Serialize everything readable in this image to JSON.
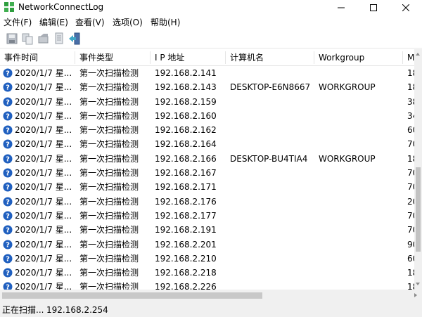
{
  "window": {
    "title": "NetworkConnectLog"
  },
  "menu": [
    {
      "label": "文件(F)"
    },
    {
      "label": "编辑(E)"
    },
    {
      "label": "查看(V)"
    },
    {
      "label": "选项(O)"
    },
    {
      "label": "帮助(H)"
    }
  ],
  "toolbar": {
    "icons": [
      "save-icon",
      "copy-icon",
      "properties-icon",
      "html-report-icon",
      "exit-icon"
    ]
  },
  "columns": [
    {
      "label": "事件时间"
    },
    {
      "label": "事件类型"
    },
    {
      "label": "I P 地址"
    },
    {
      "label": "计算机名"
    },
    {
      "label": "Workgroup"
    },
    {
      "label": "M"
    }
  ],
  "rows": [
    {
      "time": "2020/1/7 星...",
      "type": "第一次扫描检测",
      "ip": "192.168.2.141",
      "computer": "",
      "workgroup": "",
      "m": "18"
    },
    {
      "time": "2020/1/7 星...",
      "type": "第一次扫描检测",
      "ip": "192.168.2.143",
      "computer": "DESKTOP-E6N8667",
      "workgroup": "WORKGROUP",
      "m": "18"
    },
    {
      "time": "2020/1/7 星...",
      "type": "第一次扫描检测",
      "ip": "192.168.2.159",
      "computer": "",
      "workgroup": "",
      "m": "38"
    },
    {
      "time": "2020/1/7 星...",
      "type": "第一次扫描检测",
      "ip": "192.168.2.160",
      "computer": "",
      "workgroup": "",
      "m": "34"
    },
    {
      "time": "2020/1/7 星...",
      "type": "第一次扫描检测",
      "ip": "192.168.2.162",
      "computer": "",
      "workgroup": "",
      "m": "60"
    },
    {
      "time": "2020/1/7 星...",
      "type": "第一次扫描检测",
      "ip": "192.168.2.164",
      "computer": "",
      "workgroup": "",
      "m": "70"
    },
    {
      "time": "2020/1/7 星...",
      "type": "第一次扫描检测",
      "ip": "192.168.2.166",
      "computer": "DESKTOP-BU4TIA4",
      "workgroup": "WORKGROUP",
      "m": "18"
    },
    {
      "time": "2020/1/7 星...",
      "type": "第一次扫描检测",
      "ip": "192.168.2.167",
      "computer": "",
      "workgroup": "",
      "m": "70"
    },
    {
      "time": "2020/1/7 星...",
      "type": "第一次扫描检测",
      "ip": "192.168.2.171",
      "computer": "",
      "workgroup": "",
      "m": "70"
    },
    {
      "time": "2020/1/7 星...",
      "type": "第一次扫描检测",
      "ip": "192.168.2.176",
      "computer": "",
      "workgroup": "",
      "m": "20"
    },
    {
      "time": "2020/1/7 星...",
      "type": "第一次扫描检测",
      "ip": "192.168.2.177",
      "computer": "",
      "workgroup": "",
      "m": "70"
    },
    {
      "time": "2020/1/7 星...",
      "type": "第一次扫描检测",
      "ip": "192.168.2.191",
      "computer": "",
      "workgroup": "",
      "m": "70"
    },
    {
      "time": "2020/1/7 星...",
      "type": "第一次扫描检测",
      "ip": "192.168.2.201",
      "computer": "",
      "workgroup": "",
      "m": "90"
    },
    {
      "time": "2020/1/7 星...",
      "type": "第一次扫描检测",
      "ip": "192.168.2.210",
      "computer": "",
      "workgroup": "",
      "m": "60"
    },
    {
      "time": "2020/1/7 星...",
      "type": "第一次扫描检测",
      "ip": "192.168.2.218",
      "computer": "",
      "workgroup": "",
      "m": "18"
    },
    {
      "time": "2020/1/7 星...",
      "type": "第一次扫描检测",
      "ip": "192.168.2.226",
      "computer": "",
      "workgroup": "",
      "m": "18"
    }
  ],
  "status": {
    "text": "正在扫描...",
    "ip": "192.168.2.254"
  },
  "colors": {
    "row_icon": "#1f5fbf",
    "scroll_track": "#f0f0f0",
    "scroll_thumb": "#c2c2c2"
  }
}
